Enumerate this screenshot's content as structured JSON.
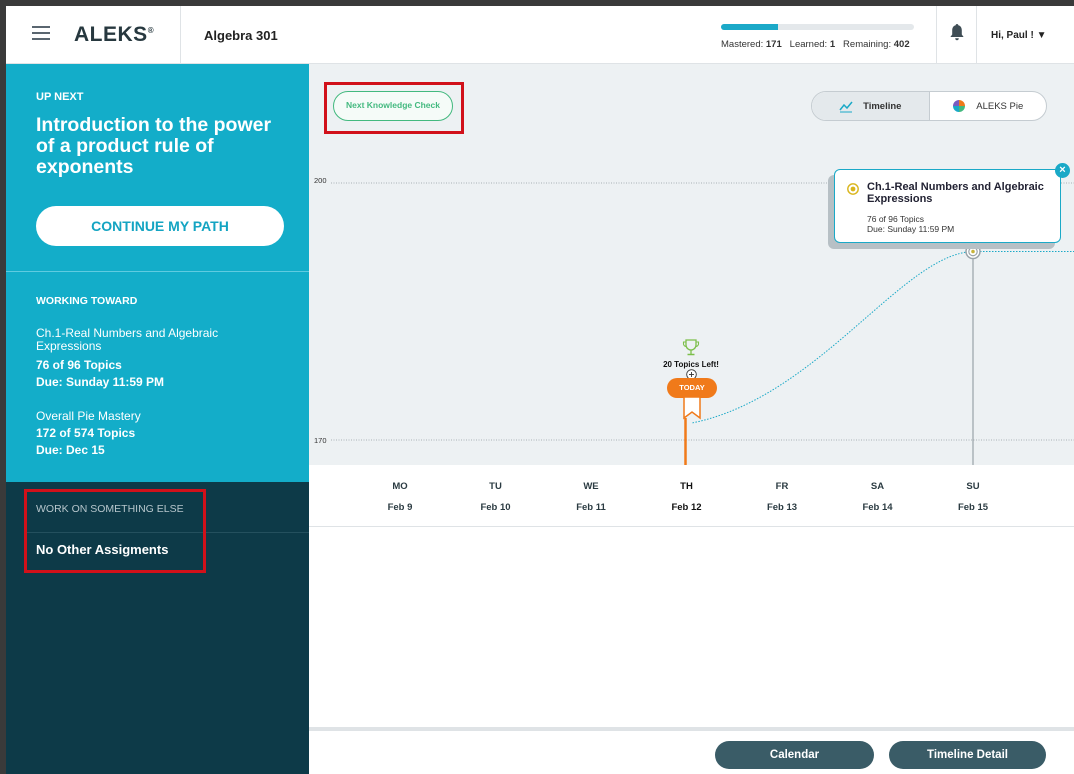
{
  "header": {
    "logo": "ALEKS",
    "logo_mark": "®",
    "course": "Algebra 301",
    "progress": {
      "mastered_label": "Mastered:",
      "mastered": "171",
      "learned_label": "Learned:",
      "learned": "1",
      "remaining_label": "Remaining:",
      "remaining": "402",
      "mastered_fraction": 0.2979
    },
    "user_greeting": "Hi, Paul !",
    "icons": [
      "hamburger-menu-icon",
      "bell-icon",
      "caret-down-icon"
    ]
  },
  "sidebar": {
    "up_next_label": "UP NEXT",
    "up_next_title": "Introduction to the power of a product rule of exponents",
    "continue_label": "CONTINUE MY PATH",
    "working_toward_label": "WORKING TOWARD",
    "goal": {
      "name": "Ch.1-Real Numbers and Algebraic Expressions",
      "topics": "76 of 96 Topics",
      "due": "Due: Sunday 11:59 PM"
    },
    "pie": {
      "name": "Overall Pie Mastery",
      "topics": "172 of 574 Topics",
      "due": "Due: Dec 15"
    },
    "something_else_label": "WORK ON SOMETHING ELSE",
    "no_assignments": "No Other Assigments"
  },
  "main": {
    "next_check_label": "Next Knowledge Check",
    "view_toggle": {
      "timeline_label": "Timeline",
      "pie_label": "ALEKS Pie",
      "selected": "Timeline"
    },
    "tooltip": {
      "title": "Ch.1-Real Numbers and Algebraic Expressions",
      "topics": "76 of 96 Topics",
      "due": "Due: Sunday 11:59 PM",
      "close": "×"
    },
    "topics_left_label": "20 Topics Left!",
    "today_label": "TODAY",
    "calendar_label": "Calendar",
    "timeline_detail_label": "Timeline Detail",
    "colors": {
      "accent": "#13adc9",
      "sidebar_dark": "#0d3a48",
      "today": "#f07a1a",
      "check_green": "#43b97f",
      "highlight_red": "#d1111a"
    }
  },
  "chart_data": {
    "type": "line",
    "y_ticks": [
      "200",
      "170"
    ],
    "ylim": [
      170,
      200
    ],
    "days": [
      {
        "dow": "MO",
        "date": "Feb 9"
      },
      {
        "dow": "TU",
        "date": "Feb 10"
      },
      {
        "dow": "WE",
        "date": "Feb 11"
      },
      {
        "dow": "TH",
        "date": "Feb 12"
      },
      {
        "dow": "FR",
        "date": "Feb 13"
      },
      {
        "dow": "SA",
        "date": "Feb 14"
      },
      {
        "dow": "SU",
        "date": "Feb 15"
      }
    ],
    "today": "Feb 12",
    "goal_day": "Feb 15",
    "series": [
      {
        "x": [
          "Feb 12",
          "Feb 15"
        ],
        "y": [
          172,
          192
        ]
      }
    ]
  }
}
